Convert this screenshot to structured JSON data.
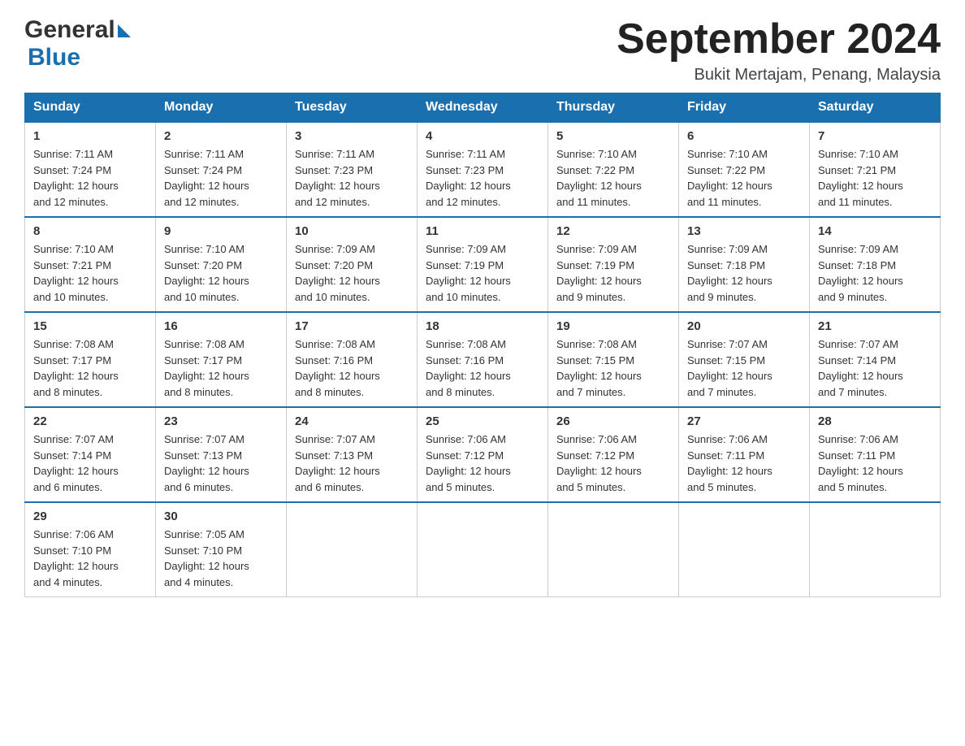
{
  "logo": {
    "general_text": "General",
    "blue_text": "Blue"
  },
  "title": {
    "month_year": "September 2024",
    "location": "Bukit Mertajam, Penang, Malaysia"
  },
  "header_days": [
    "Sunday",
    "Monday",
    "Tuesday",
    "Wednesday",
    "Thursday",
    "Friday",
    "Saturday"
  ],
  "weeks": [
    [
      {
        "day": "1",
        "sunrise": "7:11 AM",
        "sunset": "7:24 PM",
        "daylight": "12 hours and 12 minutes."
      },
      {
        "day": "2",
        "sunrise": "7:11 AM",
        "sunset": "7:24 PM",
        "daylight": "12 hours and 12 minutes."
      },
      {
        "day": "3",
        "sunrise": "7:11 AM",
        "sunset": "7:23 PM",
        "daylight": "12 hours and 12 minutes."
      },
      {
        "day": "4",
        "sunrise": "7:11 AM",
        "sunset": "7:23 PM",
        "daylight": "12 hours and 12 minutes."
      },
      {
        "day": "5",
        "sunrise": "7:10 AM",
        "sunset": "7:22 PM",
        "daylight": "12 hours and 11 minutes."
      },
      {
        "day": "6",
        "sunrise": "7:10 AM",
        "sunset": "7:22 PM",
        "daylight": "12 hours and 11 minutes."
      },
      {
        "day": "7",
        "sunrise": "7:10 AM",
        "sunset": "7:21 PM",
        "daylight": "12 hours and 11 minutes."
      }
    ],
    [
      {
        "day": "8",
        "sunrise": "7:10 AM",
        "sunset": "7:21 PM",
        "daylight": "12 hours and 10 minutes."
      },
      {
        "day": "9",
        "sunrise": "7:10 AM",
        "sunset": "7:20 PM",
        "daylight": "12 hours and 10 minutes."
      },
      {
        "day": "10",
        "sunrise": "7:09 AM",
        "sunset": "7:20 PM",
        "daylight": "12 hours and 10 minutes."
      },
      {
        "day": "11",
        "sunrise": "7:09 AM",
        "sunset": "7:19 PM",
        "daylight": "12 hours and 10 minutes."
      },
      {
        "day": "12",
        "sunrise": "7:09 AM",
        "sunset": "7:19 PM",
        "daylight": "12 hours and 9 minutes."
      },
      {
        "day": "13",
        "sunrise": "7:09 AM",
        "sunset": "7:18 PM",
        "daylight": "12 hours and 9 minutes."
      },
      {
        "day": "14",
        "sunrise": "7:09 AM",
        "sunset": "7:18 PM",
        "daylight": "12 hours and 9 minutes."
      }
    ],
    [
      {
        "day": "15",
        "sunrise": "7:08 AM",
        "sunset": "7:17 PM",
        "daylight": "12 hours and 8 minutes."
      },
      {
        "day": "16",
        "sunrise": "7:08 AM",
        "sunset": "7:17 PM",
        "daylight": "12 hours and 8 minutes."
      },
      {
        "day": "17",
        "sunrise": "7:08 AM",
        "sunset": "7:16 PM",
        "daylight": "12 hours and 8 minutes."
      },
      {
        "day": "18",
        "sunrise": "7:08 AM",
        "sunset": "7:16 PM",
        "daylight": "12 hours and 8 minutes."
      },
      {
        "day": "19",
        "sunrise": "7:08 AM",
        "sunset": "7:15 PM",
        "daylight": "12 hours and 7 minutes."
      },
      {
        "day": "20",
        "sunrise": "7:07 AM",
        "sunset": "7:15 PM",
        "daylight": "12 hours and 7 minutes."
      },
      {
        "day": "21",
        "sunrise": "7:07 AM",
        "sunset": "7:14 PM",
        "daylight": "12 hours and 7 minutes."
      }
    ],
    [
      {
        "day": "22",
        "sunrise": "7:07 AM",
        "sunset": "7:14 PM",
        "daylight": "12 hours and 6 minutes."
      },
      {
        "day": "23",
        "sunrise": "7:07 AM",
        "sunset": "7:13 PM",
        "daylight": "12 hours and 6 minutes."
      },
      {
        "day": "24",
        "sunrise": "7:07 AM",
        "sunset": "7:13 PM",
        "daylight": "12 hours and 6 minutes."
      },
      {
        "day": "25",
        "sunrise": "7:06 AM",
        "sunset": "7:12 PM",
        "daylight": "12 hours and 5 minutes."
      },
      {
        "day": "26",
        "sunrise": "7:06 AM",
        "sunset": "7:12 PM",
        "daylight": "12 hours and 5 minutes."
      },
      {
        "day": "27",
        "sunrise": "7:06 AM",
        "sunset": "7:11 PM",
        "daylight": "12 hours and 5 minutes."
      },
      {
        "day": "28",
        "sunrise": "7:06 AM",
        "sunset": "7:11 PM",
        "daylight": "12 hours and 5 minutes."
      }
    ],
    [
      {
        "day": "29",
        "sunrise": "7:06 AM",
        "sunset": "7:10 PM",
        "daylight": "12 hours and 4 minutes."
      },
      {
        "day": "30",
        "sunrise": "7:05 AM",
        "sunset": "7:10 PM",
        "daylight": "12 hours and 4 minutes."
      },
      null,
      null,
      null,
      null,
      null
    ]
  ],
  "labels": {
    "sunrise": "Sunrise:",
    "sunset": "Sunset:",
    "daylight": "Daylight:"
  }
}
